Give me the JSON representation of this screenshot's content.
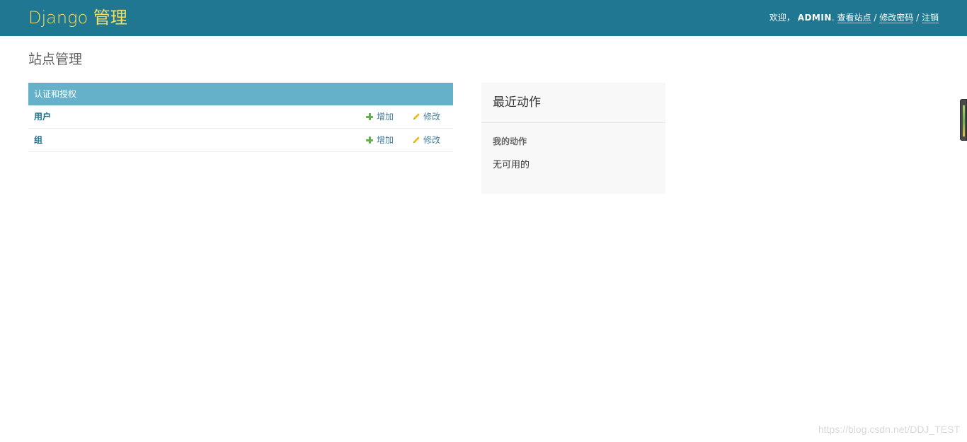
{
  "header": {
    "brand": "Django 管理",
    "welcome": "欢迎，",
    "username": "ADMIN",
    "sep_dot": ".",
    "view_site": "查看站点",
    "change_password": "修改密码",
    "logout": "注销",
    "slash": "/",
    "bg_color": "#207792",
    "brand_color": "#f5dd5d"
  },
  "page": {
    "title": "站点管理"
  },
  "module": {
    "caption": "认证和授权",
    "caption_color": "#65b1c9",
    "rows": [
      {
        "name": "用户",
        "add": "增加",
        "change": "修改"
      },
      {
        "name": "组",
        "add": "增加",
        "change": "修改"
      }
    ]
  },
  "recent": {
    "title": "最近动作",
    "my_actions": "我的动作",
    "none": "无可用的"
  },
  "watermark": "https://blog.csdn.net/DDJ_TEST"
}
